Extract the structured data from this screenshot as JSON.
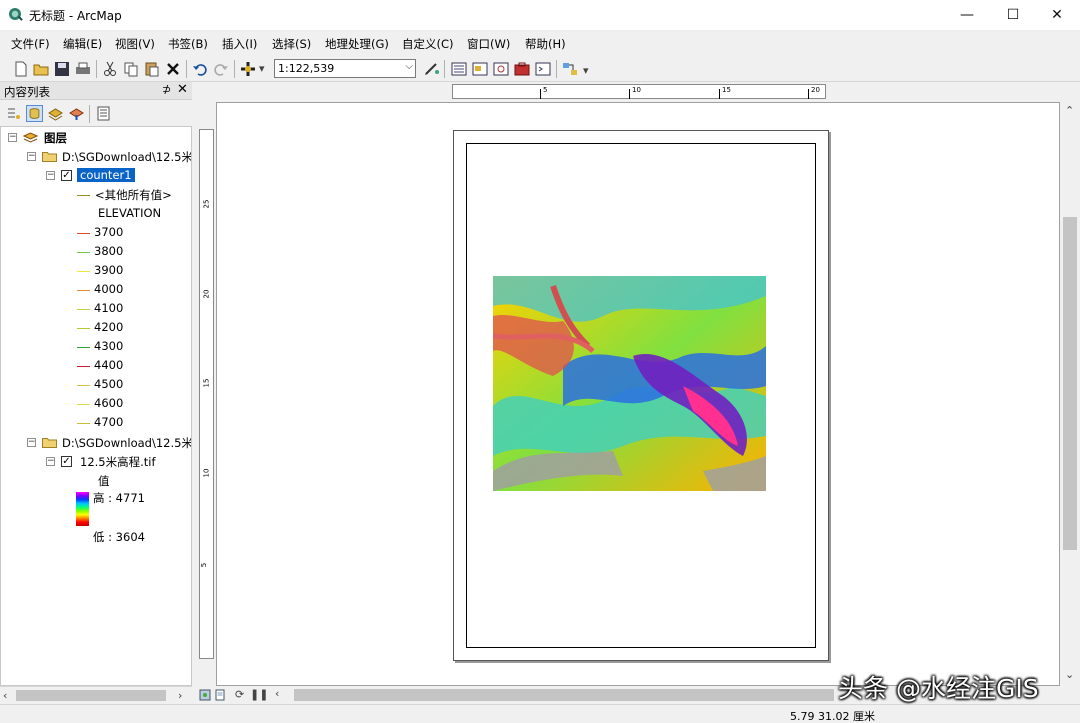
{
  "window": {
    "title": "无标题 - ArcMap",
    "minimize": "—",
    "maximize": "☐",
    "close": "✕"
  },
  "menu": [
    "文件(F)",
    "编辑(E)",
    "视图(V)",
    "书签(B)",
    "插入(I)",
    "选择(S)",
    "地理处理(G)",
    "自定义(C)",
    "窗口(W)",
    "帮助(H)"
  ],
  "toolbar": {
    "scale": "1:122,539",
    "icons": [
      "new-document-icon",
      "open-folder-icon",
      "save-icon",
      "print-icon",
      "cut-icon",
      "copy-icon",
      "paste-icon",
      "delete-icon",
      "undo-icon",
      "redo-icon",
      "add-data-icon",
      "editor-toolbar-icon",
      "toc-window-icon",
      "catalog-window-icon",
      "search-window-icon",
      "arctoolbox-icon",
      "python-window-icon",
      "model-builder-icon"
    ]
  },
  "toc": {
    "title": "内容列表",
    "pin": "⊅",
    "close": "✕",
    "root": "图层",
    "group1": {
      "path": "D:\\SGDownload\\12.5米",
      "layer": "counter1",
      "other_values": "<其他所有值>",
      "field": "ELEVATION",
      "classes": [
        {
          "label": "3700",
          "color": "#d94f2b"
        },
        {
          "label": "3800",
          "color": "#78c850"
        },
        {
          "label": "3900",
          "color": "#e8e840"
        },
        {
          "label": "4000",
          "color": "#e88a30"
        },
        {
          "label": "4100",
          "color": "#c8d040"
        },
        {
          "label": "4200",
          "color": "#b8c830"
        },
        {
          "label": "4300",
          "color": "#30a030"
        },
        {
          "label": "4400",
          "color": "#c82030"
        },
        {
          "label": "4500",
          "color": "#d8c040"
        },
        {
          "label": "4600",
          "color": "#e0d850"
        },
        {
          "label": "4700",
          "color": "#c8c030"
        }
      ],
      "other_color": "#909020"
    },
    "group2": {
      "path": "D:\\SGDownload\\12.5米",
      "layer": "12.5米高程.tif",
      "value_label": "值",
      "high": "高 : 4771",
      "low": "低 : 3604"
    }
  },
  "ruler": {
    "top": [
      "5",
      "10",
      "15",
      "20"
    ],
    "left": [
      "25",
      "20",
      "15",
      "10",
      "5"
    ]
  },
  "status": {
    "coords": "5.79  31.02 厘米"
  },
  "watermark": "头条 @水经注GIS"
}
